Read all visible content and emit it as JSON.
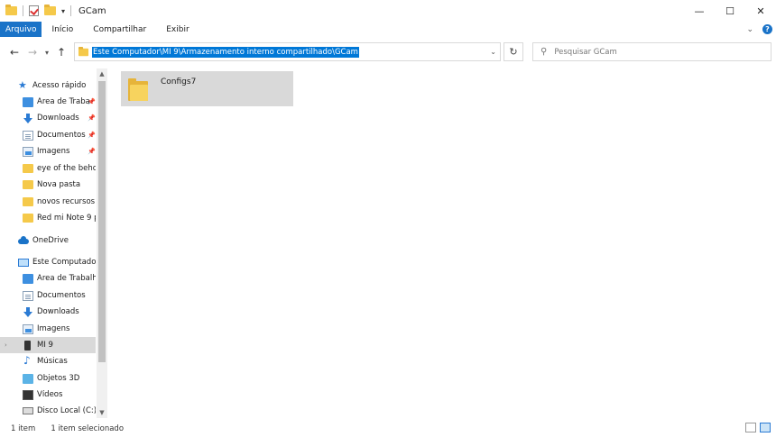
{
  "window": {
    "title": "GCam",
    "minimize": "—",
    "maximize": "☐",
    "close": "✕"
  },
  "ribbon": {
    "tabs": [
      "Arquivo",
      "Início",
      "Compartilhar",
      "Exibir"
    ],
    "help": "?"
  },
  "address": {
    "path": "Este Computador\\MI 9\\Armazenamento interno compartilhado\\GCam"
  },
  "search": {
    "placeholder": "Pesquisar GCam"
  },
  "sidebar": {
    "items": [
      {
        "label": "Acesso rápido",
        "icon": "star-icon",
        "pinned": false
      },
      {
        "label": "Área de Traba",
        "icon": "desktop-icon",
        "pinned": true
      },
      {
        "label": "Downloads",
        "icon": "download-icon",
        "pinned": true
      },
      {
        "label": "Documentos",
        "icon": "document-icon",
        "pinned": true
      },
      {
        "label": "Imagens",
        "icon": "pictures-icon",
        "pinned": true
      },
      {
        "label": "eye of the behol",
        "icon": "folder-icon",
        "pinned": false
      },
      {
        "label": "Nova pasta",
        "icon": "folder-icon",
        "pinned": false
      },
      {
        "label": "novos recursos c",
        "icon": "folder-icon",
        "pinned": false
      },
      {
        "label": "Red mi Note 9 p",
        "icon": "folder-icon",
        "pinned": false
      },
      {
        "label": "OneDrive",
        "icon": "onedrive-icon",
        "pinned": false
      },
      {
        "label": "Este Computador",
        "icon": "computer-icon",
        "pinned": false
      },
      {
        "label": "Área de Trabalho",
        "icon": "desktop-icon",
        "pinned": false
      },
      {
        "label": "Documentos",
        "icon": "document-icon",
        "pinned": false
      },
      {
        "label": "Downloads",
        "icon": "download-icon",
        "pinned": false
      },
      {
        "label": "Imagens",
        "icon": "pictures-icon",
        "pinned": false
      },
      {
        "label": "MI 9",
        "icon": "phone-icon",
        "pinned": false,
        "selected": true
      },
      {
        "label": "Músicas",
        "icon": "music-icon",
        "pinned": false
      },
      {
        "label": "Objetos 3D",
        "icon": "objects-3d-icon",
        "pinned": false
      },
      {
        "label": "Vídeos",
        "icon": "videos-icon",
        "pinned": false
      },
      {
        "label": "Disco Local (C:)",
        "icon": "disk-icon",
        "pinned": false
      }
    ]
  },
  "content": {
    "items": [
      {
        "name": "Configs7",
        "icon": "folder-icon",
        "selected": true
      }
    ]
  },
  "status": {
    "count": "1 item",
    "selected": "1 item selecionado"
  }
}
